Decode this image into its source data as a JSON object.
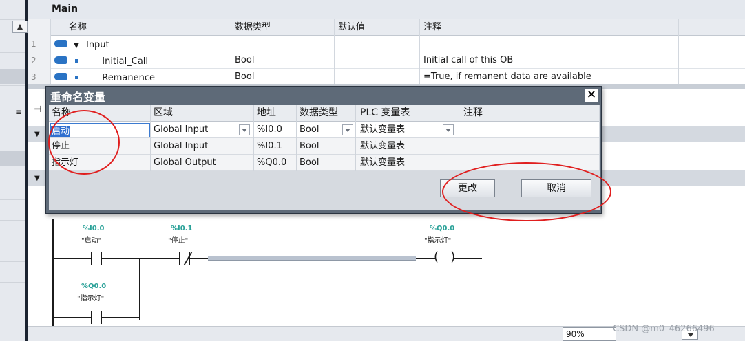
{
  "header": {
    "title": "Main"
  },
  "interface": {
    "columns": [
      "名称",
      "数据类型",
      "默认值",
      "注释"
    ],
    "rows": [
      {
        "num": "1",
        "name": "Input",
        "type": "",
        "default": "",
        "comment": ""
      },
      {
        "num": "2",
        "name": "Initial_Call",
        "type": "Bool",
        "default": "",
        "comment": "Initial call of this OB"
      },
      {
        "num": "3",
        "name": "Remanence",
        "type": "Bool",
        "default": "",
        "comment": "=True, if remanent data are available"
      }
    ]
  },
  "dialog": {
    "title": "重命名变量",
    "columns": [
      "名称",
      "区域",
      "地址",
      "数据类型",
      "PLC 变量表",
      "注释"
    ],
    "rows": [
      {
        "name": "启动",
        "area": "Global Input",
        "address": "%I0.0",
        "type": "Bool",
        "table": "默认变量表",
        "comment": ""
      },
      {
        "name": "停止",
        "area": "Global Input",
        "address": "%I0.1",
        "type": "Bool",
        "table": "默认变量表",
        "comment": ""
      },
      {
        "name": "指示灯",
        "area": "Global Output",
        "address": "%Q0.0",
        "type": "Bool",
        "table": "默认变量表",
        "comment": ""
      }
    ],
    "change_label": "更改",
    "cancel_label": "取消"
  },
  "ladder": {
    "contact1": {
      "address": "%I0.0",
      "name": "\"启动\""
    },
    "contact2": {
      "address": "%I0.1",
      "name": "\"停止\""
    },
    "coil": {
      "address": "%Q0.0",
      "name": "\"指示灯\""
    },
    "latch": {
      "address": "%Q0.0",
      "name": "\"指示灯\""
    }
  },
  "status": {
    "zoom": "90%"
  },
  "watermark": "CSDN @m0_46266496",
  "icons": [
    "up-arrow-icon",
    "expand-triangle-icon",
    "interface-io-icon",
    "close-icon",
    "dropdown-icon"
  ]
}
